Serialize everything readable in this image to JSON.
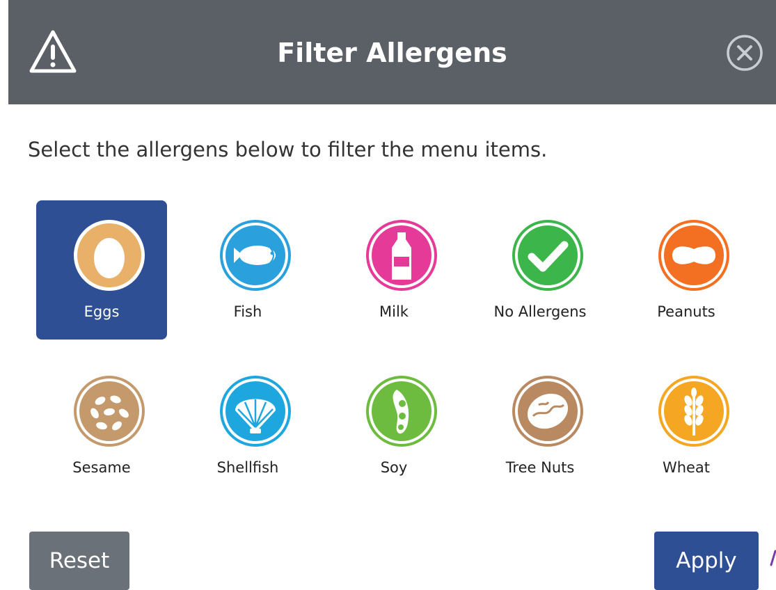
{
  "dialog": {
    "title": "Filter Allergens",
    "instructions": "Select the allergens below to filter the menu items.",
    "header_icon": "warning-icon",
    "close_icon": "close-icon"
  },
  "allergens": [
    {
      "label": "Eggs",
      "icon": "egg-icon",
      "color": "#e8b068",
      "selected": true
    },
    {
      "label": "Fish",
      "icon": "fish-icon",
      "color": "#2aa0dd",
      "selected": false
    },
    {
      "label": "Milk",
      "icon": "milk-icon",
      "color": "#e63a98",
      "selected": false
    },
    {
      "label": "No Allergens",
      "icon": "checkmark-icon",
      "color": "#3cb54a",
      "selected": false
    },
    {
      "label": "Peanuts",
      "icon": "peanut-icon",
      "color": "#f36f21",
      "selected": false
    },
    {
      "label": "Sesame",
      "icon": "sesame-icon",
      "color": "#c49a6c",
      "selected": false
    },
    {
      "label": "Shellfish",
      "icon": "shell-icon",
      "color": "#1ea7df",
      "selected": false
    },
    {
      "label": "Soy",
      "icon": "soybean-icon",
      "color": "#6dbb3f",
      "selected": false
    },
    {
      "label": "Tree Nuts",
      "icon": "walnut-icon",
      "color": "#b98a62",
      "selected": false
    },
    {
      "label": "Wheat",
      "icon": "wheat-icon",
      "color": "#f5a623",
      "selected": false
    }
  ],
  "buttons": {
    "reset_label": "Reset",
    "apply_label": "Apply"
  },
  "colors": {
    "header_bg": "#5b5f66",
    "accent": "#2e4f94",
    "reset_bg": "#6b7178"
  }
}
